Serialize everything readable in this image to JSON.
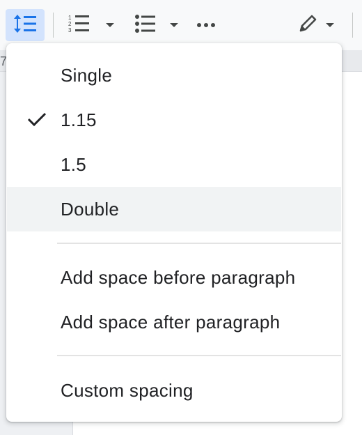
{
  "toolbar": {
    "buttons": [
      {
        "name": "line-spacing-icon",
        "active": true
      },
      {
        "name": "numbered-list-icon"
      },
      {
        "name": "bulleted-list-icon"
      },
      {
        "name": "more-options-icon"
      },
      {
        "name": "editing-mode-icon"
      }
    ],
    "accent_color": "#1a73e8"
  },
  "ruler": {
    "visible_number": "7"
  },
  "menu": {
    "spacing_options": [
      {
        "label": "Single",
        "checked": false
      },
      {
        "label": "1.15",
        "checked": true
      },
      {
        "label": "1.5",
        "checked": false
      },
      {
        "label": "Double",
        "checked": false,
        "hovered": true
      }
    ],
    "paragraph_actions": [
      {
        "label": "Add space before paragraph"
      },
      {
        "label": "Add space after paragraph"
      }
    ],
    "custom": {
      "label": "Custom spacing"
    }
  }
}
